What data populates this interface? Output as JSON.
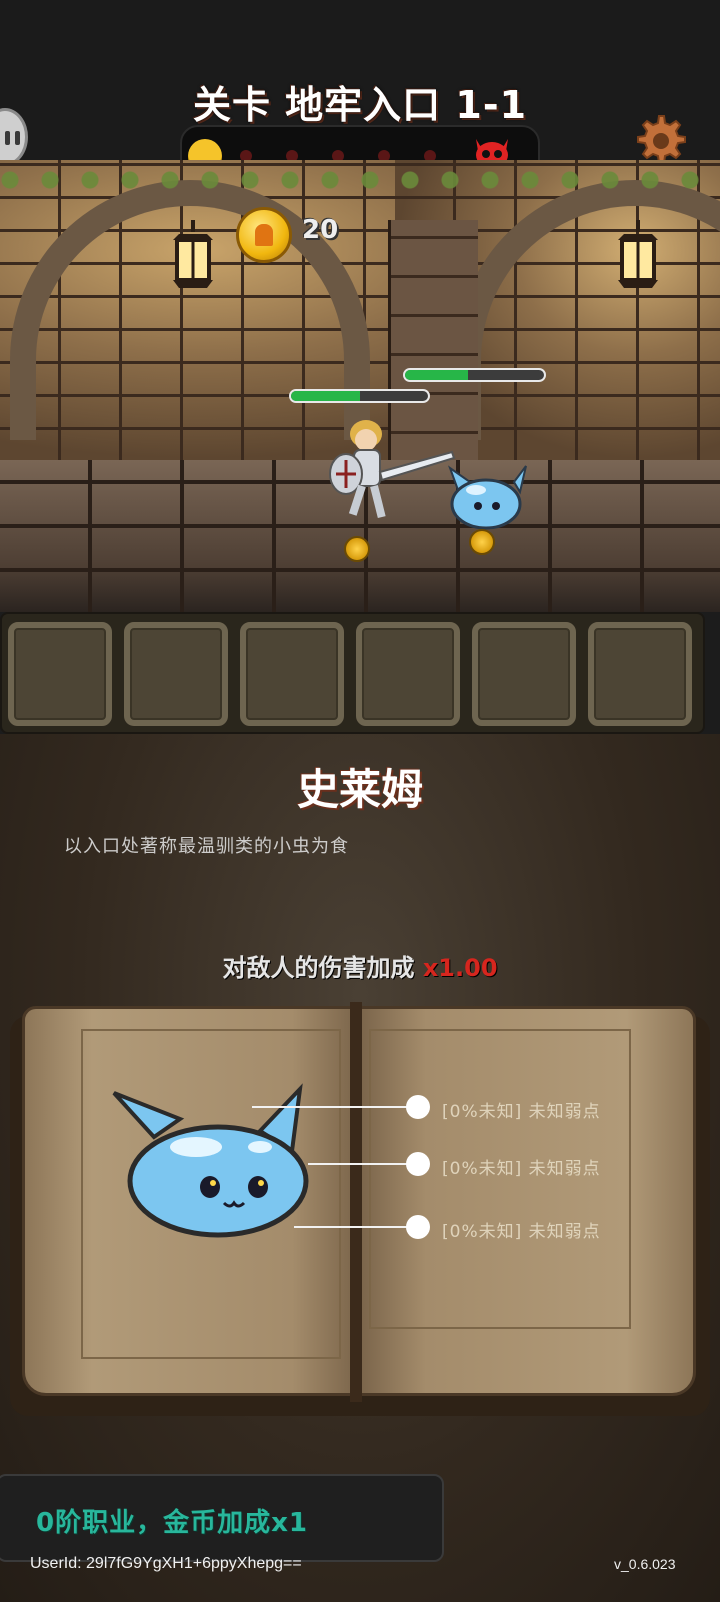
{
  "header": {
    "stage_title": "关卡 地牢入口 1-1",
    "wave_progress": {
      "current": 1,
      "total": 7,
      "boss_icon": "boss-skull-icon"
    }
  },
  "icons": {
    "pause": "pause-icon",
    "settings": "gear-icon",
    "coin": "coin-icon"
  },
  "battle": {
    "coins": "20",
    "hero_hp": 0.5,
    "enemy_hp": 0.45
  },
  "inventory": {
    "slots": 6
  },
  "enemy_info": {
    "name": "史莱姆",
    "description": "以入口处著称最温驯类的小虫为食",
    "damage_label": "对敌人的伤害加成 ",
    "damage_multiplier": "x1.00",
    "traits": [
      "[0%未知] 未知弱点",
      "[0%未知] 未知弱点",
      "[0%未知] 未知弱点"
    ]
  },
  "footer": {
    "class_text": "0阶职业，金币加成x1",
    "user_id": "UserId: 29l7fG9YgXH1+6ppyXhepg==",
    "version": "v_0.6.023"
  },
  "colors": {
    "accent_coin": "#f5c42a",
    "damage_red": "#d6261e",
    "class_teal": "#28b79c",
    "hp_green": "#27b648"
  }
}
